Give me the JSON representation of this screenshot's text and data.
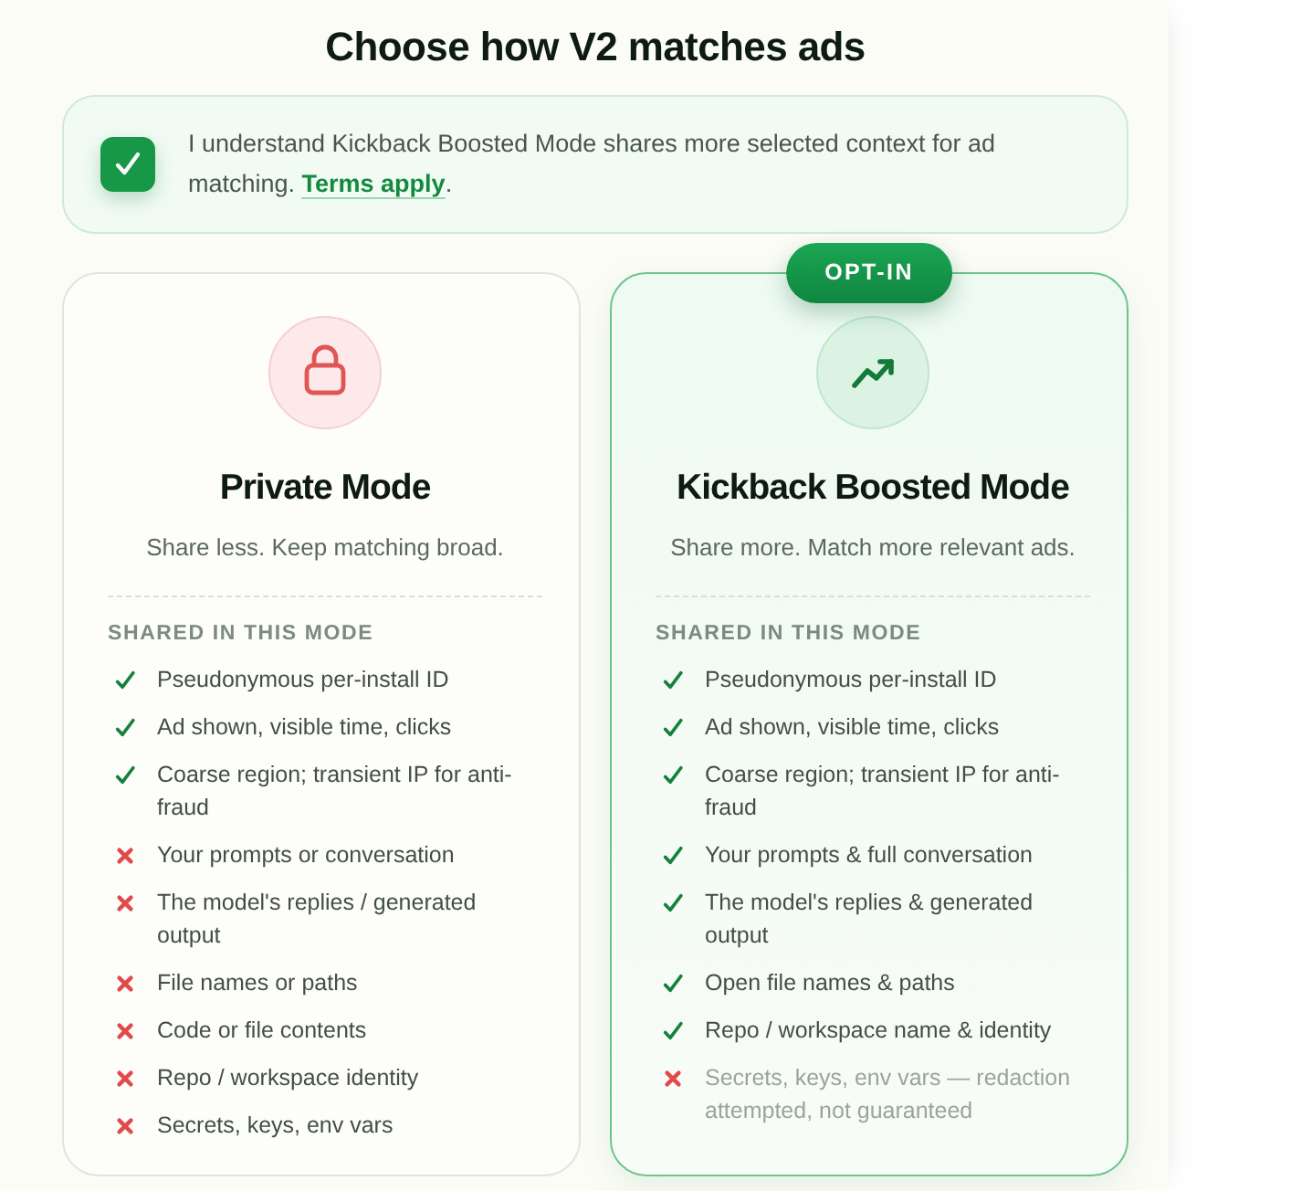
{
  "title": "Choose how V2 matches ads",
  "consent": {
    "checked": true,
    "text": "I understand Kickback Boosted Mode shares more selected context for ad matching.",
    "link": "Terms apply",
    "after": "."
  },
  "modes": [
    {
      "kind": "private",
      "selected": false,
      "name": "Private Mode",
      "tagline": "Share less. Keep matching broad.",
      "section_label": "SHARED IN THIS MODE",
      "items": [
        {
          "text": "Pseudonymous per-install ID",
          "shared": true,
          "muted": false
        },
        {
          "text": "Ad shown, visible time, clicks",
          "shared": true,
          "muted": false
        },
        {
          "text": "Coarse region; transient IP for anti-fraud",
          "shared": true,
          "muted": false
        },
        {
          "text": "Your prompts or conversation",
          "shared": false,
          "muted": false
        },
        {
          "text": "The model's replies / generated output",
          "shared": false,
          "muted": false
        },
        {
          "text": "File names or paths",
          "shared": false,
          "muted": false
        },
        {
          "text": "Code or file contents",
          "shared": false,
          "muted": false
        },
        {
          "text": "Repo / workspace identity",
          "shared": false,
          "muted": false
        },
        {
          "text": "Secrets, keys, env vars",
          "shared": false,
          "muted": false
        }
      ]
    },
    {
      "kind": "boosted",
      "selected": true,
      "badge": "OPT-IN",
      "name": "Kickback Boosted Mode",
      "tagline": "Share more. Match more relevant ads.",
      "section_label": "SHARED IN THIS MODE",
      "items": [
        {
          "text": "Pseudonymous per-install ID",
          "shared": true,
          "muted": false
        },
        {
          "text": "Ad shown, visible time, clicks",
          "shared": true,
          "muted": false
        },
        {
          "text": "Coarse region; transient IP for anti-fraud",
          "shared": true,
          "muted": false
        },
        {
          "text": "Your prompts & full conversation",
          "shared": true,
          "muted": false
        },
        {
          "text": "The model's replies & generated output",
          "shared": true,
          "muted": false
        },
        {
          "text": "Open file names & paths",
          "shared": true,
          "muted": false
        },
        {
          "text": "Repo / workspace name & identity",
          "shared": true,
          "muted": false
        },
        {
          "text": "Secrets, keys, env vars — redaction attempted, not guaranteed",
          "shared": false,
          "muted": true
        }
      ]
    }
  ]
}
